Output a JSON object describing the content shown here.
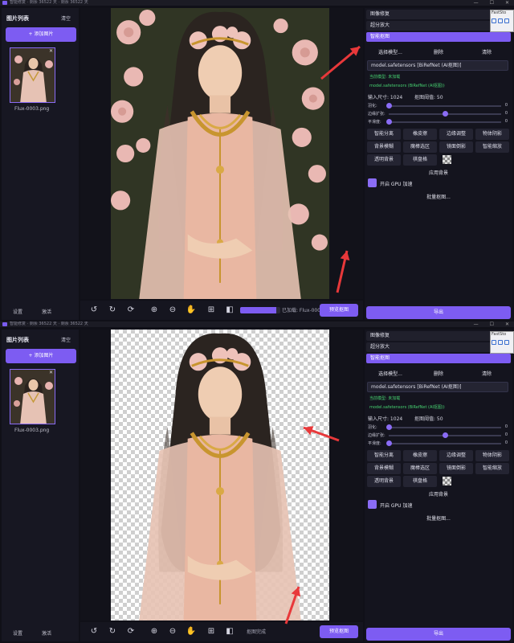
{
  "screens": [
    {
      "titlebar": {
        "text": "智能修复 · 剩余 36522 天 · 剩余 36522 天",
        "controls": [
          "—",
          "☐",
          "✕"
        ]
      },
      "sidebar": {
        "title": "图片列表",
        "clear_label": "清空",
        "add_label": "+ 添加图片",
        "thumb_label": "Flux-0003.png",
        "close_glyph": "✕",
        "settings_label": "设置",
        "activate_label": "激活"
      },
      "toolbar": {
        "progress_fraction": 0.9,
        "status": "已加载: Flux-0003...",
        "preview_label": "预览抠图"
      },
      "panel": {
        "tabs": [
          "图像修复",
          "超分放大",
          "智能抠图"
        ],
        "model_buttons": [
          "选择模型...",
          "删除",
          "清除"
        ],
        "model_name": "model.safetensors [BiRefNet (AI抠图)]",
        "current_model": "当前模型: 未加载",
        "model_info": "model.safetensors (BiRefNet (AI抠图))",
        "input_size_label": "输入尺寸: 1024",
        "threshold_label": "抠图阈值: 50",
        "sliders": [
          {
            "label": "羽化:",
            "fraction": 0.0,
            "value": "0"
          },
          {
            "label": "边缘扩张:",
            "fraction": 0.5,
            "value": "0"
          },
          {
            "label": "平滑度:",
            "fraction": 0.0,
            "value": "0"
          }
        ],
        "grid_row1": [
          "智能分离",
          "橡皮擦",
          "边缘调整",
          "物体阴影"
        ],
        "grid_row2": [
          "背景模糊",
          "魔棒选区",
          "镜面倒影",
          "智能缩放"
        ],
        "grid_row3": [
          "透明背景",
          "棋盘格"
        ],
        "apply_label": "应用背景",
        "gpu_label": "开启 GPU 加速",
        "batch_label": "批量抠图...",
        "export_label": "导出"
      },
      "faststone": {
        "title": "FastSto"
      }
    },
    {
      "titlebar": {
        "text": "智能修复 · 剩余 36522 天 · 剩余 36522 天",
        "controls": [
          "—",
          "☐",
          "✕"
        ]
      },
      "sidebar": {
        "title": "图片列表",
        "clear_label": "清空",
        "add_label": "+ 添加图片",
        "thumb_label": "Flux-0003.png",
        "close_glyph": "✕",
        "settings_label": "设置",
        "activate_label": "激活"
      },
      "toolbar": {
        "status": "抠图完成",
        "preview_label": "预览抠图"
      },
      "panel": {
        "tabs": [
          "图像修复",
          "超分放大",
          "智能抠图"
        ],
        "model_buttons": [
          "选择模型...",
          "删除",
          "清除"
        ],
        "model_name": "model.safetensors [BiRefNet (AI抠图)]",
        "current_model": "当前模型: 未加载",
        "model_info": "model.safetensors (BiRefNet (AI抠图))",
        "input_size_label": "输入尺寸: 1024",
        "threshold_label": "抠图阈值: 50",
        "sliders": [
          {
            "label": "羽化:",
            "fraction": 0.0,
            "value": "0"
          },
          {
            "label": "边缘扩张:",
            "fraction": 0.5,
            "value": "0"
          },
          {
            "label": "平滑度:",
            "fraction": 0.0,
            "value": "0"
          }
        ],
        "grid_row1": [
          "智能分离",
          "橡皮擦",
          "边缘调整",
          "物体阴影"
        ],
        "grid_row2": [
          "背景模糊",
          "魔棒选区",
          "镜面倒影",
          "智能缩放"
        ],
        "grid_row3": [
          "透明背景",
          "棋盘格"
        ],
        "apply_label": "应用背景",
        "gpu_label": "开启 GPU 加速",
        "batch_label": "批量抠图...",
        "export_label": "导出"
      },
      "faststone": {
        "title": "FastSto"
      }
    }
  ],
  "tool_icons": [
    "rotate-left-icon",
    "redo-icon",
    "refresh-icon",
    "zoom-in-icon",
    "zoom-out-icon",
    "hand-icon",
    "fit-icon",
    "compare-icon"
  ],
  "colors": {
    "accent": "#7d5cf2",
    "arrow": "#e8383a",
    "status_green": "#46d070"
  }
}
